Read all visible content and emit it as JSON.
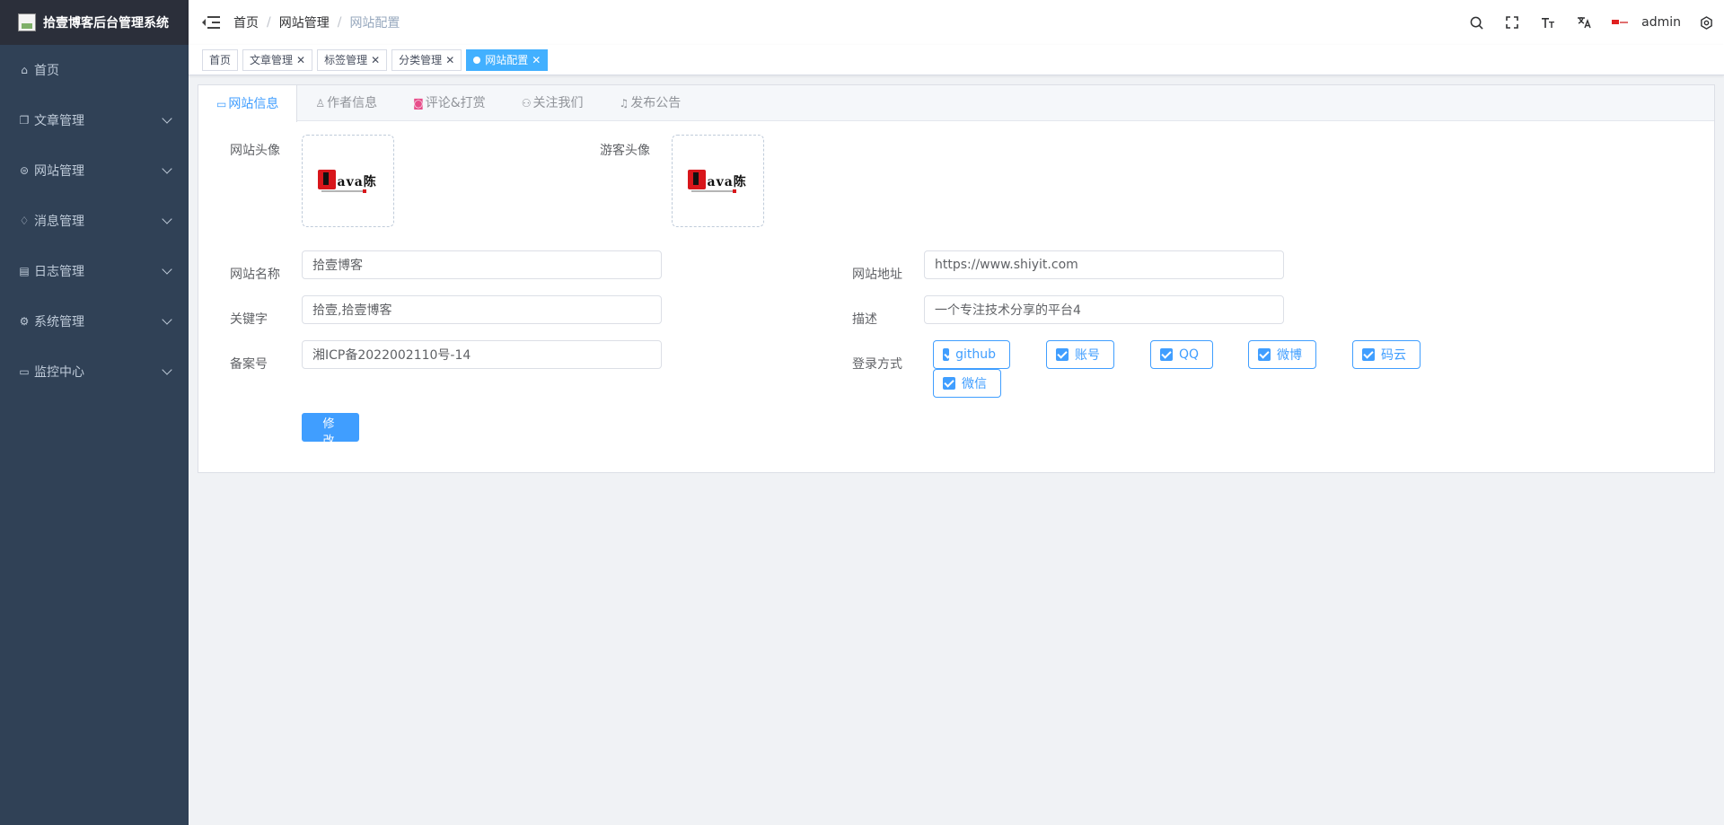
{
  "app": {
    "title": "拾壹博客后台管理系统"
  },
  "sidebar": {
    "items": [
      {
        "label": "首页",
        "icon": "home-icon",
        "has_children": false
      },
      {
        "label": "文章管理",
        "icon": "documents-icon",
        "has_children": true
      },
      {
        "label": "网站管理",
        "icon": "website-icon",
        "has_children": true
      },
      {
        "label": "消息管理",
        "icon": "bell-icon",
        "has_children": true
      },
      {
        "label": "日志管理",
        "icon": "log-icon",
        "has_children": true
      },
      {
        "label": "系统管理",
        "icon": "gear-icon",
        "has_children": true
      },
      {
        "label": "监控中心",
        "icon": "monitor-icon",
        "has_children": true
      }
    ]
  },
  "breadcrumb": {
    "items": [
      "首页",
      "网站管理"
    ],
    "current": "网站配置",
    "separator": "/"
  },
  "navbar": {
    "username": "admin",
    "icons": [
      "search-icon",
      "fullscreen-icon",
      "font-size-icon",
      "translate-icon",
      "flag-icon",
      "settings-icon"
    ]
  },
  "tags": [
    {
      "label": "首页",
      "closable": false,
      "active": false
    },
    {
      "label": "文章管理",
      "closable": true,
      "active": false
    },
    {
      "label": "标签管理",
      "closable": true,
      "active": false
    },
    {
      "label": "分类管理",
      "closable": true,
      "active": false
    },
    {
      "label": "网站配置",
      "closable": true,
      "active": true
    }
  ],
  "tabs": [
    {
      "label": "网站信息",
      "active": true,
      "icon": "monitor-icon"
    },
    {
      "label": "作者信息",
      "active": false,
      "icon": "user-icon"
    },
    {
      "label": "评论&打赏",
      "active": false,
      "icon": "comment-icon"
    },
    {
      "label": "关注我们",
      "active": false,
      "icon": "users-icon"
    },
    {
      "label": "发布公告",
      "active": false,
      "icon": "bell-icon"
    }
  ],
  "form": {
    "site_avatar_label": "网站头像",
    "guest_avatar_label": "游客头像",
    "avatar_text": "ava陈",
    "site_name_label": "网站名称",
    "site_name": "拾壹博客",
    "site_url_label": "网站地址",
    "site_url": "https://www.shiyit.com",
    "keywords_label": "关键字",
    "keywords": "拾壹,拾壹博客",
    "description_label": "描述",
    "description": "一个专注技术分享的平台4",
    "icp_label": "备案号",
    "icp": "湘ICP备2022002110号-14",
    "login_label": "登录方式",
    "login_methods": [
      {
        "label": "github",
        "checked": true
      },
      {
        "label": "账号",
        "checked": true
      },
      {
        "label": "QQ",
        "checked": true
      },
      {
        "label": "微博",
        "checked": true
      },
      {
        "label": "码云",
        "checked": true
      },
      {
        "label": "微信",
        "checked": true
      }
    ],
    "submit_label": "修 改"
  },
  "colors": {
    "primary": "#409eff",
    "sidebar_bg": "#304156",
    "logo_bg": "#2b2f3a",
    "tag_active": "#42b0ff"
  }
}
